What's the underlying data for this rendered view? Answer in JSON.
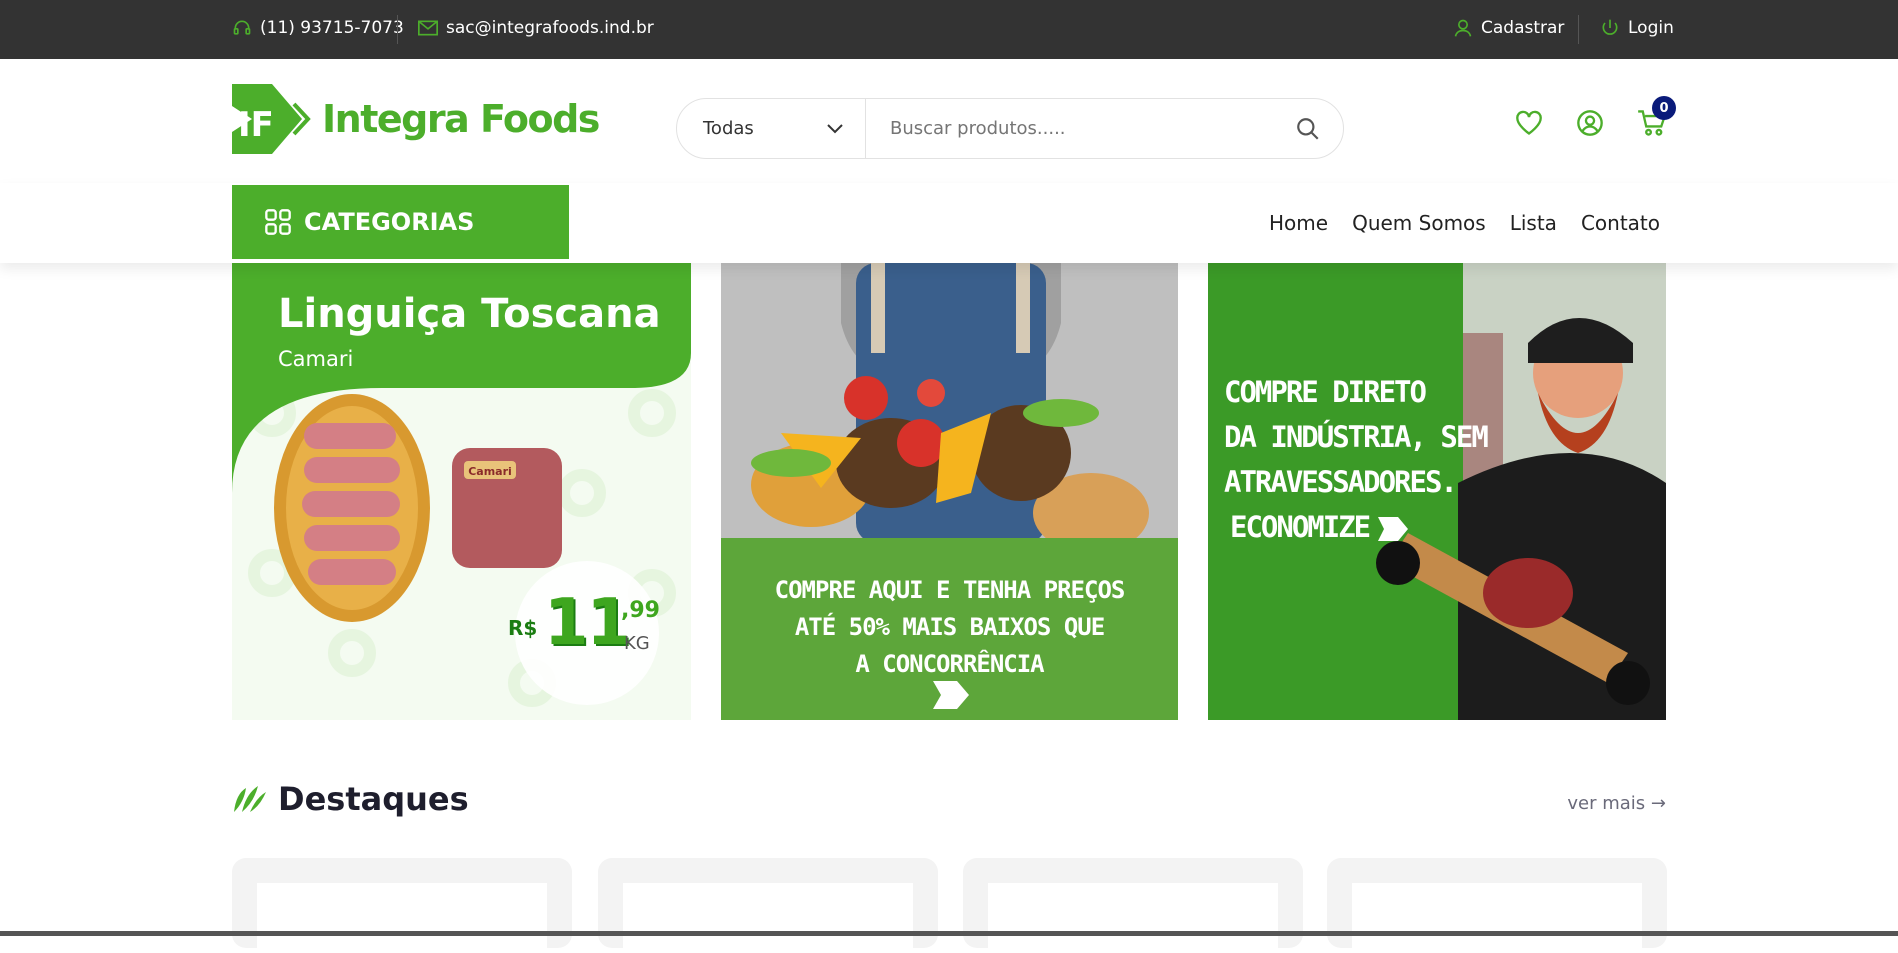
{
  "topbar": {
    "phone": "(11) 93715-7073",
    "email": "sac@integrafoods.ind.br",
    "register": "Cadastrar",
    "login": "Login"
  },
  "header": {
    "logo_mark": "IF",
    "logo_text": "Integra Foods",
    "search": {
      "category_selected": "Todas",
      "placeholder": "Buscar produtos....."
    },
    "cart_count": "0"
  },
  "nav": {
    "categories_label": "CATEGORIAS",
    "links": [
      "Home",
      "Quem Somos",
      "Lista",
      "Contato"
    ]
  },
  "banners": {
    "left": {
      "title": "Linguiça Toscana",
      "brand": "Camari",
      "package_label": "Camari",
      "currency": "R$",
      "price_int": "11",
      "price_cents": ",99",
      "unit": "KG"
    },
    "middle": {
      "line1": "COMPRE AQUI E TENHA PREÇOS",
      "line2": "ATÉ 50% MAIS BAIXOS QUE",
      "line3": "A CONCORRÊNCIA"
    },
    "right": {
      "line1": "COMPRE DIRETO",
      "line2": "DA INDÚSTRIA, SEM",
      "line3": "ATRAVESSADORES.",
      "line4": "ECONOMIZE"
    }
  },
  "section": {
    "title": "Destaques",
    "see_more": "ver mais →"
  },
  "colors": {
    "brand_green": "#4cae2b",
    "topbar_bg": "#333333",
    "badge_bg": "#0a1b7a"
  }
}
